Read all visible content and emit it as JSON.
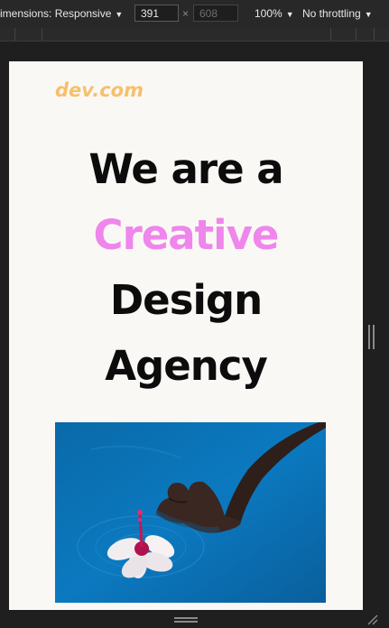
{
  "devtools": {
    "dimensions_label": "imensions: Responsive",
    "width_value": "391",
    "height_value": "608",
    "times": "×",
    "zoom": "100%",
    "throttling": "No throttling"
  },
  "page": {
    "logo": "dev.com",
    "headline_line1": "We are a",
    "headline_accent": "Creative",
    "headline_line3": "Design",
    "headline_line4": "Agency",
    "hero_image_alt": "Hand touching a flower floating on blue water"
  },
  "colors": {
    "logo": "#f6c06b",
    "accent": "#ee86ec",
    "frame_bg": "#faf8f5",
    "water": "#0a73b6"
  },
  "icons": [
    "chevron-down-icon",
    "resize-handle-icon",
    "corner-resize-icon"
  ]
}
